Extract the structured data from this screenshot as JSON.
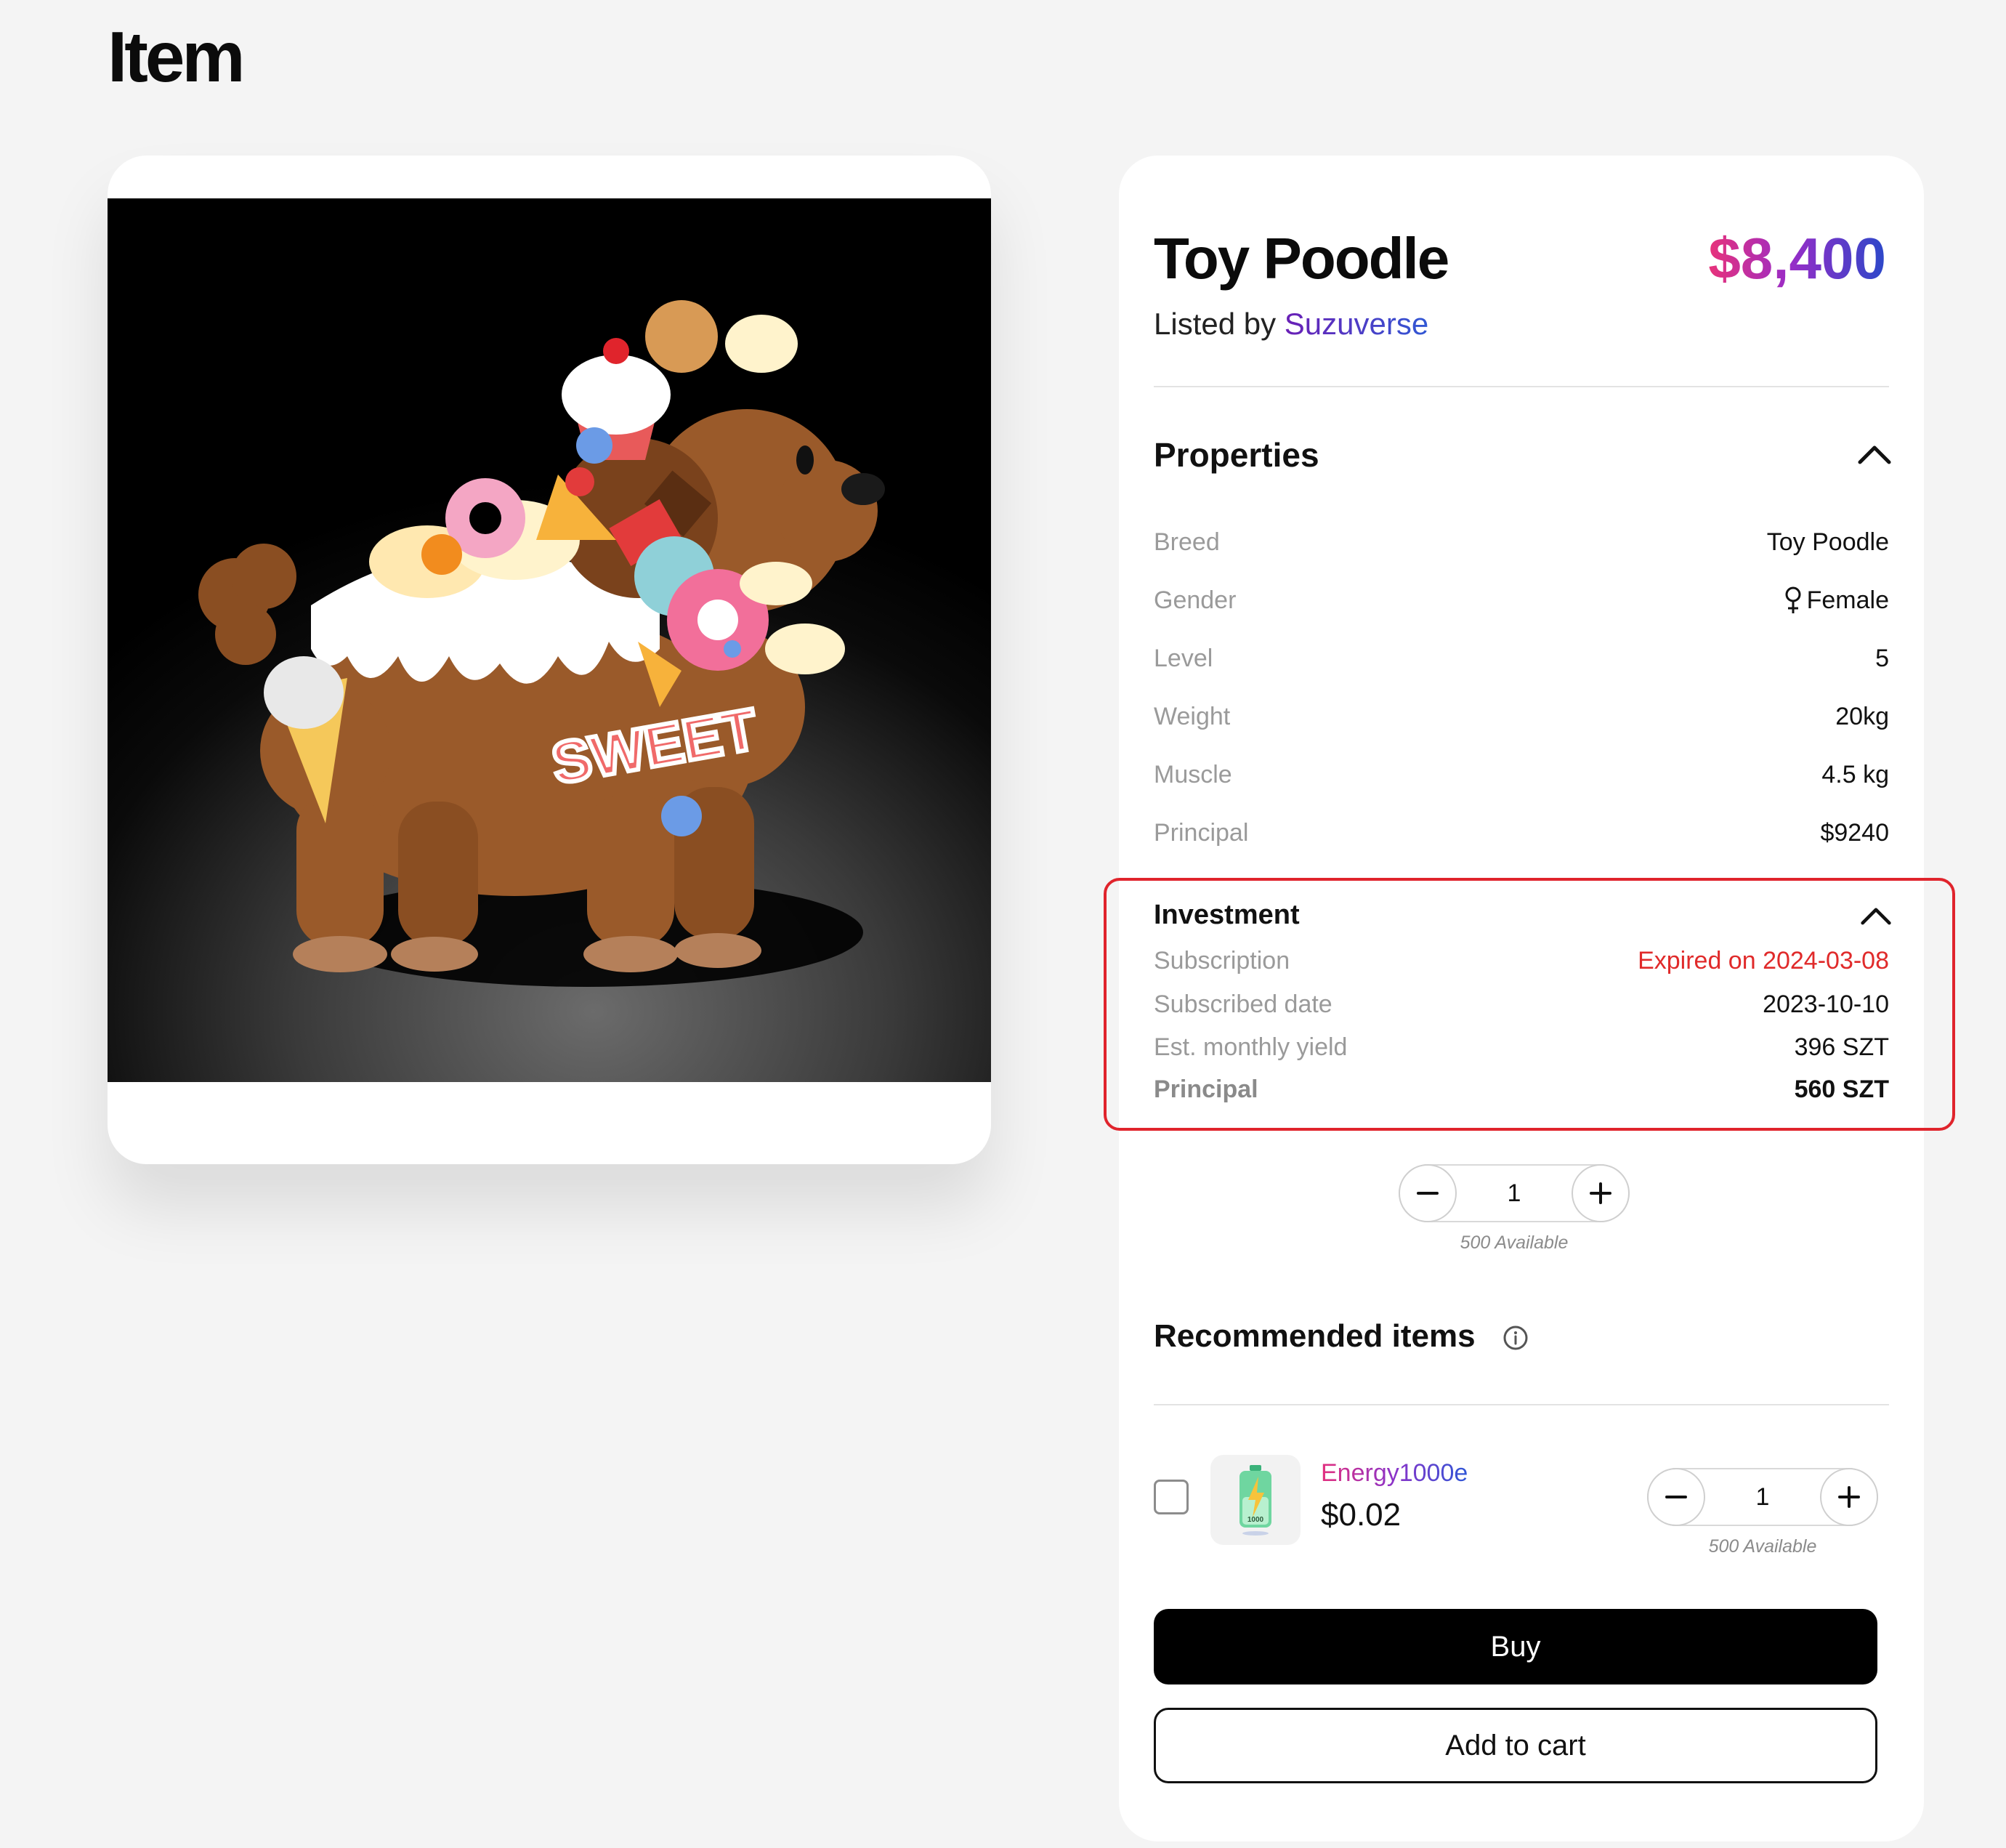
{
  "page": {
    "title": "Item"
  },
  "item": {
    "name": "Toy Poodle",
    "price": "$8,400",
    "listed_by_prefix": "Listed by",
    "seller": "Suzuverse",
    "image_text": "SWEET"
  },
  "properties": {
    "title": "Properties",
    "rows": [
      {
        "label": "Breed",
        "value": "Toy Poodle"
      },
      {
        "label": "Gender",
        "value": "Female",
        "icon": "female-icon"
      },
      {
        "label": "Level",
        "value": "5"
      },
      {
        "label": "Weight",
        "value": "20kg"
      },
      {
        "label": "Muscle",
        "value": "4.5 kg"
      },
      {
        "label": "Principal",
        "value": "$9240"
      }
    ]
  },
  "investment": {
    "title": "Investment",
    "rows": [
      {
        "label": "Subscription",
        "value": "Expired on 2024-03-08"
      },
      {
        "label": "Subscribed date",
        "value": "2023-10-10"
      },
      {
        "label": "Est. monthly yield",
        "value": "396 SZT"
      },
      {
        "label": "Principal",
        "value": "560 SZT"
      }
    ]
  },
  "quantity": {
    "value": "1",
    "available": "500 Available"
  },
  "recommended": {
    "title": "Recommended items",
    "items": [
      {
        "name": "Energy1000e",
        "price": "$0.02",
        "quantity": "1",
        "available": "500 Available",
        "thumb_text": "1000"
      }
    ]
  },
  "actions": {
    "buy": "Buy",
    "add_to_cart": "Add to cart"
  },
  "colors": {
    "accent_red": "#e0242c",
    "expired": "#e02a2a",
    "price_gradient": [
      "#e8327a",
      "#9a2cc7",
      "#2b48c9"
    ]
  }
}
